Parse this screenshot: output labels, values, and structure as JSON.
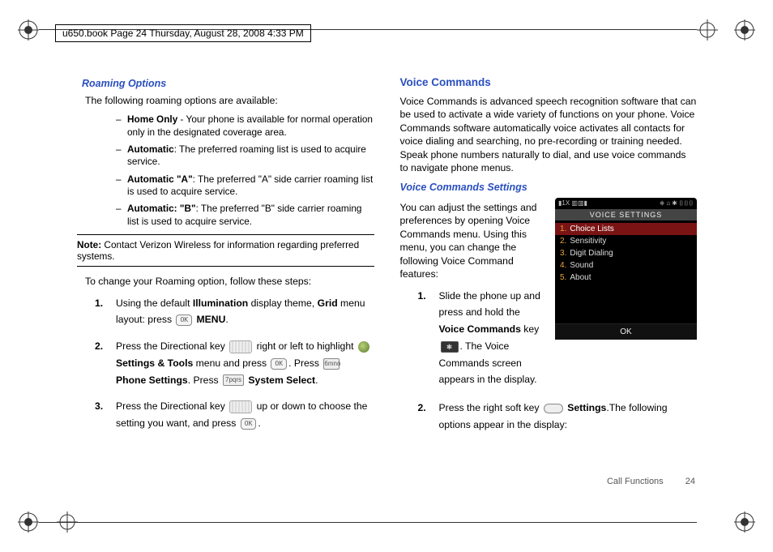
{
  "header_line": "u650.book  Page 24  Thursday, August 28, 2008  4:33 PM",
  "left": {
    "h3": "Roaming Options",
    "intro": "The following roaming options are available:",
    "items": [
      {
        "b": "Home Only",
        "t": " - Your phone is available for normal operation only in the designated coverage area."
      },
      {
        "b": "Automatic",
        "t": ": The preferred roaming list is used to acquire service."
      },
      {
        "b": "Automatic \"A\"",
        "t": ": The preferred \"A\" side carrier roaming list is used to acquire service."
      },
      {
        "b": "Automatic: \"B\"",
        "t": ": The preferred \"B\" side carrier roaming list is used to acquire service."
      }
    ],
    "note_label": "Note: ",
    "note_text": "Contact Verizon Wireless for information regarding preferred systems.",
    "change_intro": "To change your Roaming option, follow these steps:",
    "step1_a": "Using the default ",
    "step1_b1": "Illumination",
    "step1_c": " display theme, ",
    "step1_b2": "Grid",
    "step1_d": " menu layout: press ",
    "ok_label": "OK",
    "step1_e": " ",
    "step1_b3": "MENU",
    "step1_f": ".",
    "step2_a": "Press the Directional key ",
    "step2_b": " right or left to highlight ",
    "step2_b1": "Settings & Tools",
    "step2_c": " menu and press ",
    "step2_d": ". Press ",
    "menu6": "6mno",
    "step2_b2": "Phone Settings",
    "step2_e": ". Press ",
    "menu7": "7pqrs",
    "step2_b3": "System Select",
    "step2_f": ".",
    "step3_a": "Press the Directional key ",
    "step3_b": " up or down to choose the setting you want, and press ",
    "step3_c": "."
  },
  "right": {
    "h2": "Voice Commands",
    "intro": "Voice Commands is advanced speech recognition software that can be used to activate a wide variety of functions on your phone. Voice Commands software automatically voice activates all contacts for voice dialing and searching, no pre-recording or training needed. Speak phone numbers naturally to dial, and use voice commands to navigate phone menus.",
    "h3": "Voice Commands Settings",
    "settings_intro": "You can adjust the settings and preferences by opening Voice Commands menu. Using this menu, you can change the following Voice Command features:",
    "step1_a": "Slide the phone up and press and hold the ",
    "step1_b1": "Voice Commands",
    "step1_b": " key ",
    "star_label": "✱",
    "step1_c": ". The Voice Commands screen appears in the display.",
    "step2_a": "Press the right soft key ",
    "step2_b1": "Settings",
    "step2_b": ".The following options appear in the display:",
    "phone": {
      "status_left": "▮1X ▥▥▮",
      "status_right": "⎈  ⌂  ✱  ▯▯▯",
      "title": "VOICE SETTINGS",
      "items": [
        {
          "n": "1.",
          "t": "Choice Lists"
        },
        {
          "n": "2.",
          "t": "Sensitivity"
        },
        {
          "n": "3.",
          "t": "Digit Dialing"
        },
        {
          "n": "4.",
          "t": "Sound"
        },
        {
          "n": "5.",
          "t": "About"
        }
      ],
      "footer": "OK"
    }
  },
  "footer_section": "Call Functions",
  "footer_page": "24"
}
